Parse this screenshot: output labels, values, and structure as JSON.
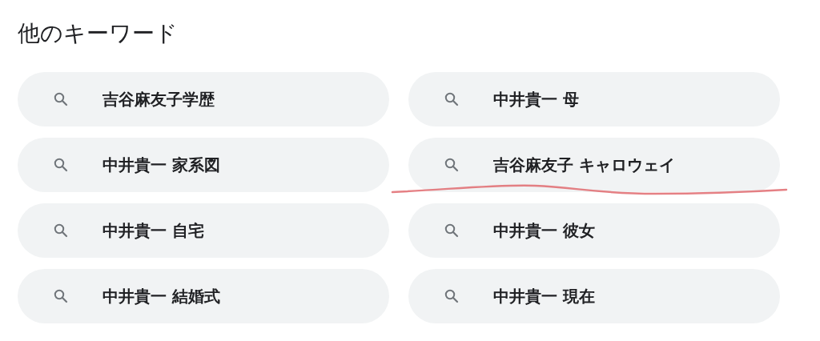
{
  "title": "他のキーワード",
  "items": [
    {
      "text": "吉谷麻友子学歴",
      "underlined": false
    },
    {
      "text": "中井貴一 母",
      "underlined": false
    },
    {
      "text": "中井貴一 家系図",
      "underlined": false
    },
    {
      "text": "吉谷麻友子 キャロウェイ",
      "underlined": true
    },
    {
      "text": "中井貴一 自宅",
      "underlined": false
    },
    {
      "text": "中井貴一 彼女",
      "underlined": false
    },
    {
      "text": "中井貴一 結婚式",
      "underlined": false
    },
    {
      "text": "中井貴一 現在",
      "underlined": false
    }
  ]
}
